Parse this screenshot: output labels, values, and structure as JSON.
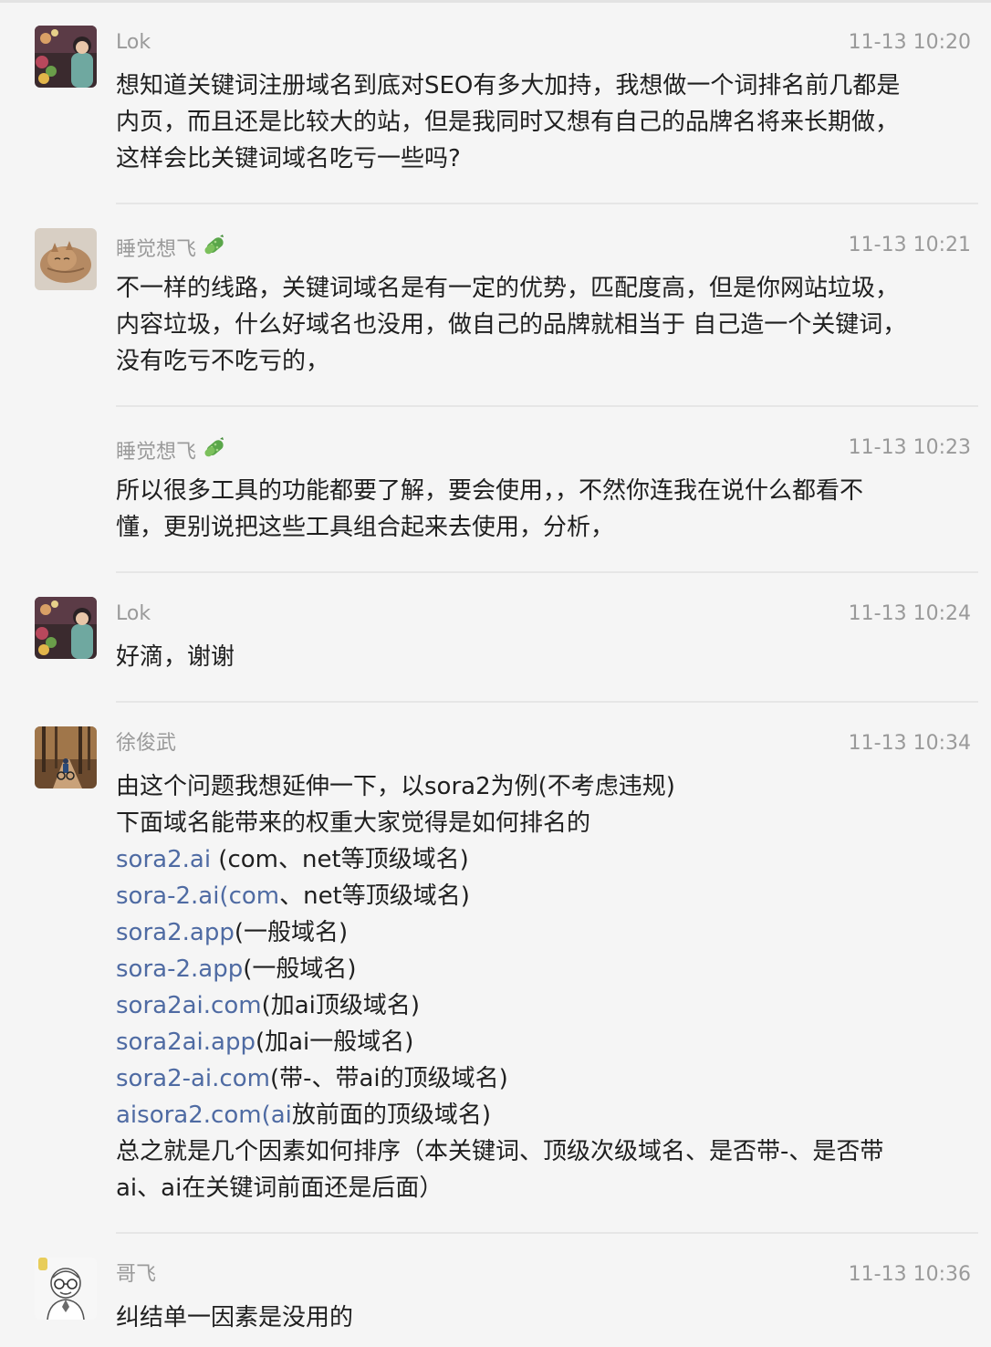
{
  "messages": [
    {
      "sender": "Lok",
      "time": "11-13 10:20",
      "lines": [
        "想知道关键词注册域名到底对SEO有多大加持，我想做一个词排名前几都是",
        "内页，而且还是比较大的站，但是我同时又想有自己的品牌名将来长期做，",
        "这样会比关键词域名吃亏一些吗?"
      ]
    },
    {
      "sender": "睡觉想飞",
      "time": "11-13 10:21",
      "lines": [
        "不一样的线路，关键词域名是有一定的优势，匹配度高，但是你网站垃圾，",
        "内容垃圾，什么好域名也没用，做自己的品牌就相当于 自己造一个关键词，",
        "没有吃亏不吃亏的，"
      ]
    },
    {
      "sender": "睡觉想飞",
      "time": "11-13 10:23",
      "lines": [
        "所以很多工具的功能都要了解，要会使用，，不然你连我在说什么都看不",
        "懂，更别说把这些工具组合起来去使用，分析，"
      ]
    },
    {
      "sender": "Lok",
      "time": "11-13 10:24",
      "lines": [
        "好滴，谢谢"
      ]
    },
    {
      "sender": "徐俊武",
      "time": "11-13 10:34",
      "intro": [
        "由这个问题我想延伸一下，以sora2为例(不考虑违规)",
        "下面域名能带来的权重大家觉得是如何排名的"
      ],
      "domains": [
        {
          "link": "sora2.ai",
          "note": " (com、net等顶级域名)"
        },
        {
          "link": "sora-2.ai(com",
          "note": "、net等顶级域名)"
        },
        {
          "link": "sora2.app",
          "note": "(一般域名)"
        },
        {
          "link": "sora-2.app",
          "note": "(一般域名)"
        },
        {
          "link": "sora2ai.com",
          "note": "(加ai顶级域名)"
        },
        {
          "link": "sora2ai.app",
          "note": "(加ai一般域名)"
        },
        {
          "link": "sora2-ai.com",
          "note": "(带-、带ai的顶级域名)"
        },
        {
          "link": "aisora2.com(ai",
          "note": "放前面的顶级域名)"
        }
      ],
      "outro": [
        "总之就是几个因素如何排序（本关键词、顶级次级域名、是否带-、是否带",
        "ai、ai在关键词前面还是后面）"
      ]
    },
    {
      "sender": "哥飞",
      "time": "11-13 10:36",
      "lines": [
        "纠结单一因素是没用的"
      ]
    }
  ],
  "icons": {
    "member_badge": "cucumber-badge-icon"
  },
  "colors": {
    "background": "#f5f5f5",
    "link": "#4f6ba3",
    "meta_text": "#9a9a9a",
    "body_text": "#1f1f1f"
  }
}
